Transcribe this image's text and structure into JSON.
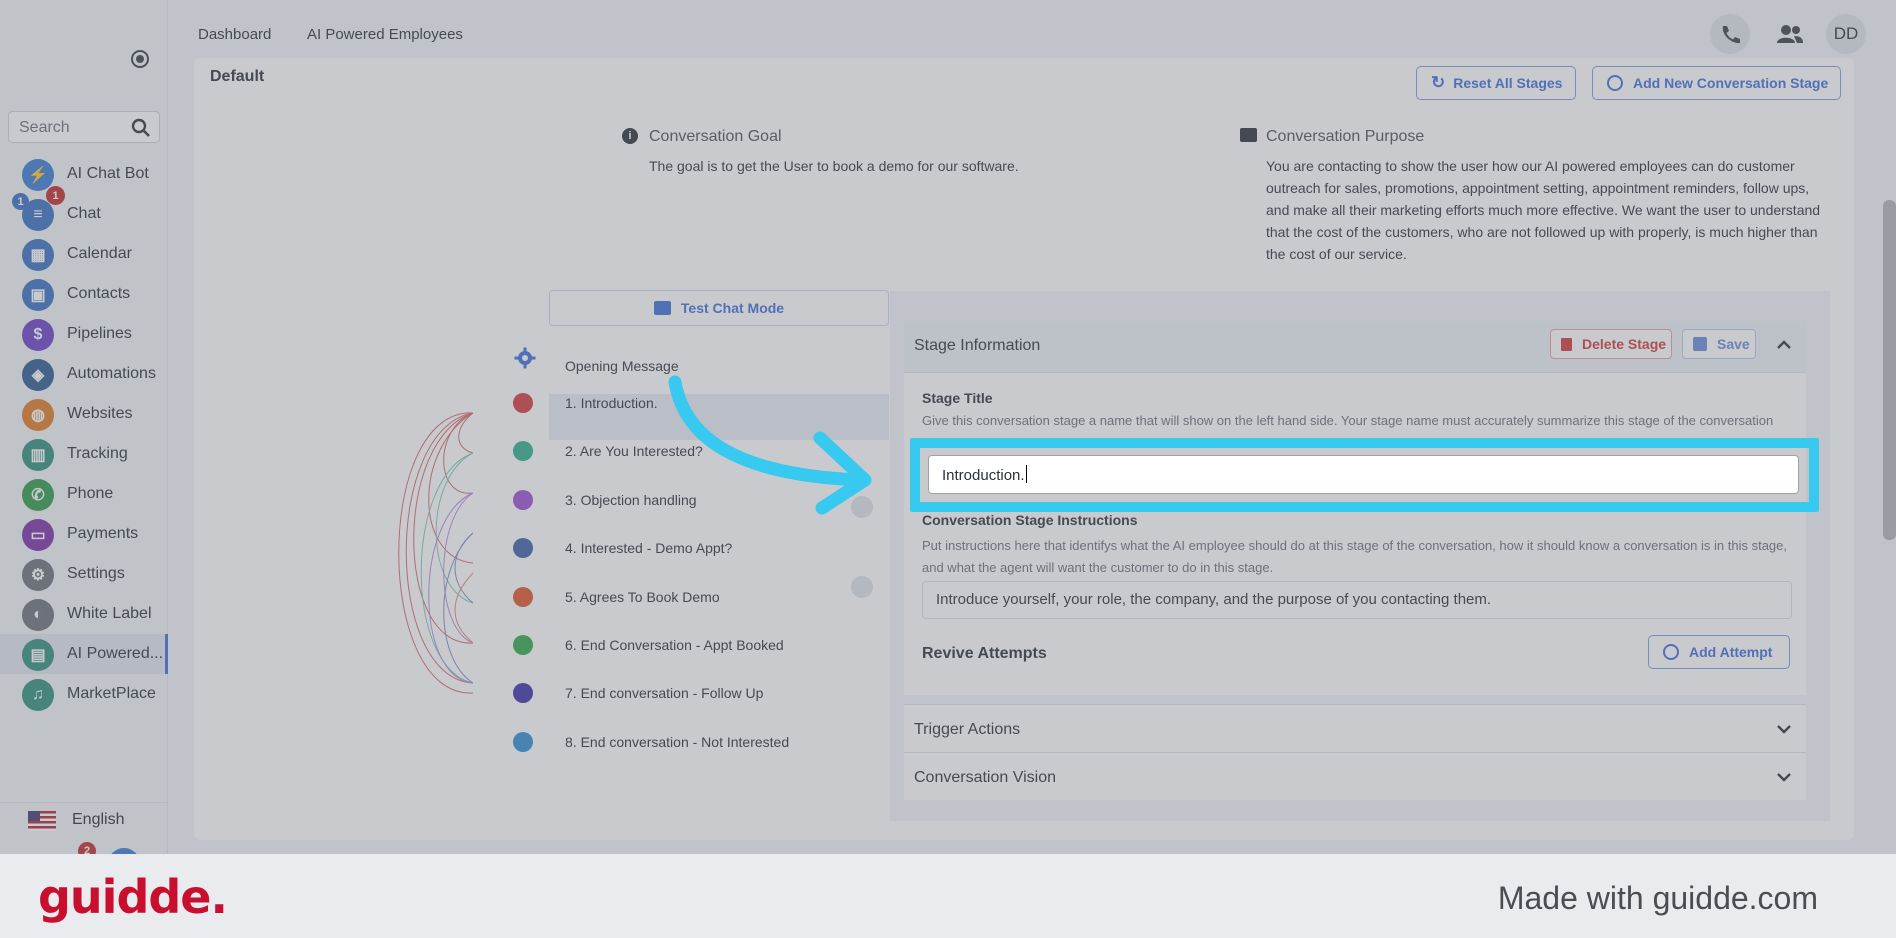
{
  "sidebar": {
    "search_placeholder": "Search",
    "items": [
      {
        "label": "AI Chat Bot",
        "icon": "bolt-icon",
        "color": "#3a7bd5"
      },
      {
        "label": "Chat",
        "icon": "chat-icon",
        "color": "#3a6fc4"
      },
      {
        "label": "Calendar",
        "icon": "calendar-icon",
        "color": "#3a6fc4"
      },
      {
        "label": "Contacts",
        "icon": "contacts-icon",
        "color": "#3a6fc4"
      },
      {
        "label": "Pipelines",
        "icon": "dollar-icon",
        "color": "#6a3fc7"
      },
      {
        "label": "Automations",
        "icon": "automation-icon",
        "color": "#2c5a8c"
      },
      {
        "label": "Websites",
        "icon": "globe-icon",
        "color": "#e07a1f"
      },
      {
        "label": "Tracking",
        "icon": "chart-icon",
        "color": "#2f8f7a"
      },
      {
        "label": "Phone",
        "icon": "phone-icon",
        "color": "#2f9a4a"
      },
      {
        "label": "Payments",
        "icon": "card-icon",
        "color": "#7b2fa5"
      },
      {
        "label": "Settings",
        "icon": "gear-icon",
        "color": "#6b7078"
      },
      {
        "label": "White Label",
        "icon": "palette-icon",
        "color": "#6b7078"
      },
      {
        "label": "AI Powered...",
        "icon": "ai-chat-icon",
        "color": "#2f8f7a"
      },
      {
        "label": "MarketPlace",
        "icon": "mic-icon",
        "color": "#2f8f7a"
      }
    ],
    "chat_badge_left": "1",
    "chat_badge_right": "1",
    "footer_badge": "2",
    "language": "English"
  },
  "topbar": {
    "tabs": [
      "Dashboard",
      "AI Powered Employees"
    ],
    "avatar": "DD"
  },
  "card": {
    "section": "Default",
    "reset_label": "Reset All Stages",
    "add_stage_label": "Add New Conversation Stage",
    "goal_title": "Conversation Goal",
    "goal_text": "The goal is to get the User to book a demo for our software.",
    "purpose_title": "Conversation Purpose",
    "purpose_text": "You are contacting to show the user how our AI powered employees can do customer outreach for sales, promotions, appointment setting, appointment reminders, follow ups, and make all their marketing efforts much more effective. We want the user to understand that the cost of the customers, who are not followed up with properly, is much higher than the cost of our service.",
    "test_chat_label": "Test Chat Mode",
    "opening_message": "Opening Message",
    "stages": [
      {
        "label": "1. Introduction.",
        "color": "#d23a3a"
      },
      {
        "label": "2. Are You Interested?",
        "color": "#2fae8a"
      },
      {
        "label": "3. Objection handling",
        "color": "#9b4fd0"
      },
      {
        "label": "4. Interested - Demo Appt?",
        "color": "#3f5fa8"
      },
      {
        "label": "5. Agrees To Book Demo",
        "color": "#e0562a"
      },
      {
        "label": "6. End Conversation - Appt Booked",
        "color": "#2faa4a"
      },
      {
        "label": "7. End conversation - Follow Up",
        "color": "#3a2fa8"
      },
      {
        "label": "8. End conversation - Not Interested",
        "color": "#2f8fd6"
      }
    ]
  },
  "panel": {
    "header": "Stage Information",
    "delete_label": "Delete Stage",
    "save_label": "Save",
    "stage_title_label": "Stage Title",
    "stage_title_help": "Give this conversation stage a name that will show on the left hand side. Your stage name must accurately summarize this stage of the conversation",
    "stage_title_value": "Introduction.",
    "instructions_label": "Conversation Stage Instructions",
    "instructions_help": "Put instructions here that identifys what the AI employee should do at this stage of the conversation, how it should know a conversation is in this stage, and what the agent will want the customer to do in this stage.",
    "instructions_value": "Introduce yourself, your role, the company, and the purpose of you contacting them.",
    "revive_label": "Revive Attempts",
    "add_attempt_label": "Add Attempt",
    "trigger_label": "Trigger Actions",
    "vision_label": "Conversation Vision"
  },
  "footer": {
    "brand": "guidde.",
    "made_with": "Made with guidde.com"
  },
  "colors": {
    "highlight": "#38c9f0",
    "accent": "#3f6fd8",
    "brand": "#c8102e"
  }
}
